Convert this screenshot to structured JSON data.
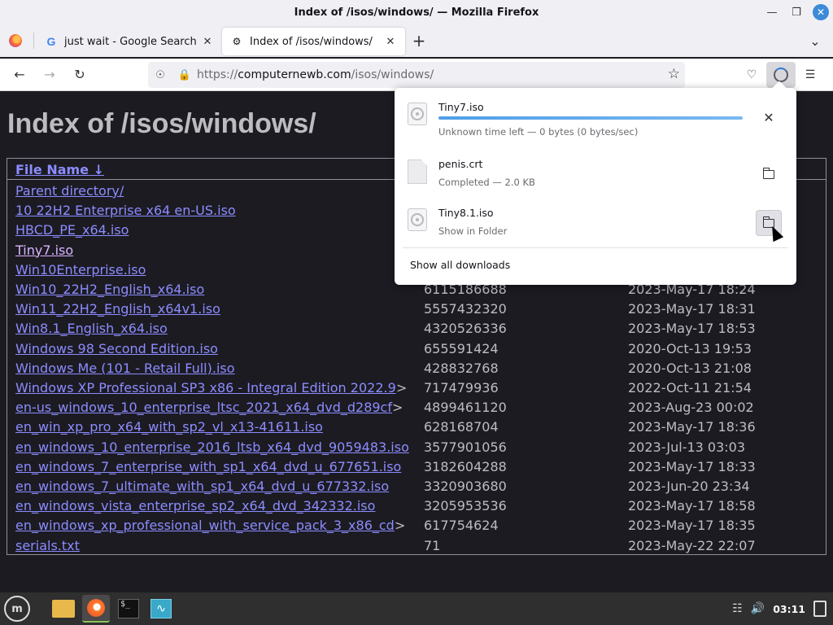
{
  "window": {
    "title": "Index of /isos/windows/ — Mozilla Firefox"
  },
  "tabs": [
    {
      "label": "just wait - Google Search",
      "favicon": "G",
      "active": false
    },
    {
      "label": "Index of /isos/windows/",
      "active": true
    }
  ],
  "navbar": {
    "url_prefix": "https://",
    "url_host": "computernewb.com",
    "url_path": "/isos/windows/"
  },
  "page": {
    "heading": "Index of /isos/windows/",
    "column_header": "File Name  ↓",
    "rows": [
      {
        "name": "Parent directory/",
        "size": "",
        "date": "",
        "visited": false
      },
      {
        "name": "10 22H2 Enterprise x64 en-US.iso",
        "size": "",
        "date": "",
        "visited": false
      },
      {
        "name": "HBCD_PE_x64.iso",
        "size": "",
        "date": "",
        "visited": false
      },
      {
        "name": "Tiny7.iso",
        "size": "",
        "date": "",
        "visited": true
      },
      {
        "name": "Win10Enterprise.iso",
        "size": "",
        "date": "",
        "visited": false
      },
      {
        "name": "Win10_22H2_English_x64.iso",
        "size": "6115186688",
        "date": "2023-May-17 18:24",
        "visited": false
      },
      {
        "name": "Win11_22H2_English_x64v1.iso",
        "size": "5557432320",
        "date": "2023-May-17 18:31",
        "visited": false
      },
      {
        "name": "Win8.1_English_x64.iso",
        "size": "4320526336",
        "date": "2023-May-17 18:53",
        "visited": false
      },
      {
        "name": "Windows 98 Second Edition.iso",
        "size": "655591424",
        "date": "2020-Oct-13 19:53",
        "visited": false
      },
      {
        "name": "Windows Me (101 - Retail Full).iso",
        "size": "428832768",
        "date": "2020-Oct-13 21:08",
        "visited": false
      },
      {
        "name": "Windows XP Professional SP3 x86 - Integral Edition 2022.9",
        "trunc": ">",
        "size": "717479936",
        "date": "2022-Oct-11 21:54",
        "visited": false
      },
      {
        "name": "en-us_windows_10_enterprise_ltsc_2021_x64_dvd_d289cf",
        "trunc": ">",
        "size": "4899461120",
        "date": "2023-Aug-23 00:02",
        "visited": false
      },
      {
        "name": "en_win_xp_pro_x64_with_sp2_vl_x13-41611.iso",
        "size": "628168704",
        "date": "2023-May-17 18:36",
        "visited": false
      },
      {
        "name": "en_windows_10_enterprise_2016_ltsb_x64_dvd_9059483.iso",
        "size": "3577901056",
        "date": "2023-Jul-13 03:03",
        "visited": false
      },
      {
        "name": "en_windows_7_enterprise_with_sp1_x64_dvd_u_677651.iso",
        "size": "3182604288",
        "date": "2023-May-17 18:33",
        "visited": false
      },
      {
        "name": "en_windows_7_ultimate_with_sp1_x64_dvd_u_677332.iso",
        "size": "3320903680",
        "date": "2023-Jun-20 23:34",
        "visited": false
      },
      {
        "name": "en_windows_vista_enterprise_sp2_x64_dvd_342332.iso",
        "size": "3205953536",
        "date": "2023-May-17 18:58",
        "visited": false
      },
      {
        "name": "en_windows_xp_professional_with_service_pack_3_x86_cd",
        "trunc": ">",
        "size": "617754624",
        "date": "2023-May-17 18:35",
        "visited": false
      },
      {
        "name": "serials.txt",
        "size": "71",
        "date": "2023-May-22 22:07",
        "visited": false
      }
    ]
  },
  "downloads": {
    "items": [
      {
        "name": "Tiny7.iso",
        "status": "Unknown time left — 0 bytes (0 bytes/sec)",
        "icon": "disc-icon",
        "action": "cancel",
        "progress": 1.0
      },
      {
        "name": "penis.crt",
        "status": "Completed — 2.0 KB",
        "icon": "document-icon",
        "action": "show-in-folder"
      },
      {
        "name": "Tiny8.1.iso",
        "status": "Show in Folder",
        "icon": "disc-icon",
        "action": "show-in-folder"
      }
    ],
    "show_all": "Show all downloads"
  },
  "taskbar": {
    "menu_label": "m",
    "terminal_label": "$_",
    "clock": "03:11"
  }
}
